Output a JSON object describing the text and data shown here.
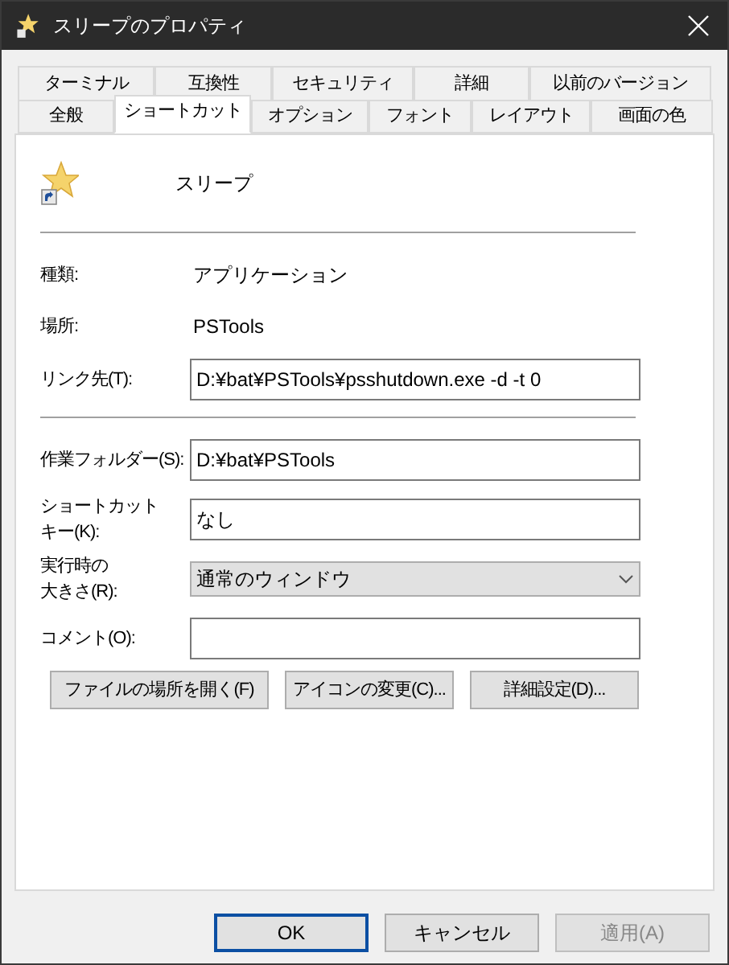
{
  "window": {
    "title": "スリープのプロパティ"
  },
  "tab_rows": [
    [
      {
        "label": "ターミナル",
        "selected": false
      },
      {
        "label": "互換性",
        "selected": false
      },
      {
        "label": "セキュリティ",
        "selected": false
      },
      {
        "label": "詳細",
        "selected": false
      },
      {
        "label": "以前のバージョン",
        "selected": false
      }
    ],
    [
      {
        "label": "全般",
        "selected": false
      },
      {
        "label": "ショートカット",
        "selected": true
      },
      {
        "label": "オプション",
        "selected": false
      },
      {
        "label": "フォント",
        "selected": false
      },
      {
        "label": "レイアウト",
        "selected": false
      },
      {
        "label": "画面の色",
        "selected": false
      }
    ]
  ],
  "shortcut": {
    "name": "スリープ"
  },
  "info": [
    {
      "label": "種類:",
      "value": "アプリケーション"
    },
    {
      "label": "場所:",
      "value": "PSTools"
    }
  ],
  "target": {
    "label": "リンク先(T):",
    "value": "D:¥bat¥PSTools¥psshutdown.exe -d -t 0"
  },
  "fields": [
    {
      "kind": "input",
      "label": "作業フォルダー(S):",
      "value": "D:¥bat¥PSTools"
    },
    {
      "kind": "input",
      "label": [
        "ショートカット",
        "キー(K):"
      ],
      "value": "なし"
    },
    {
      "kind": "select",
      "label": [
        "実行時の",
        "大きさ(R):"
      ],
      "value": "通常のウィンドウ"
    },
    {
      "kind": "input",
      "label": "コメント(O):"
    }
  ],
  "actions": [
    "ファイルの場所を開く(F)",
    "アイコンの変更(C)...",
    "詳細設定(D)..."
  ],
  "buttons": [
    {
      "label": "OK",
      "default": true,
      "disabled": false
    },
    {
      "label": "キャンセル",
      "default": false,
      "disabled": false
    },
    {
      "label": "適用(A)",
      "default": false,
      "disabled": true
    }
  ]
}
